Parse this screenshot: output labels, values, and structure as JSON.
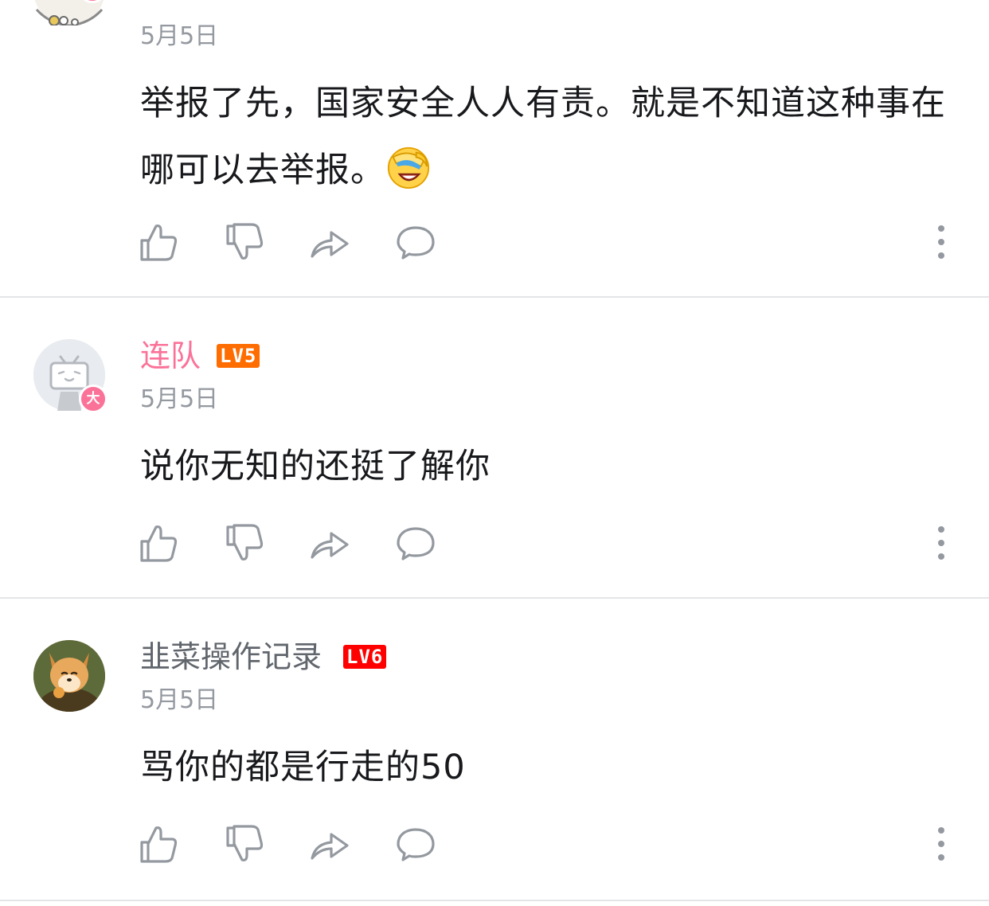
{
  "comments": [
    {
      "username": "",
      "level": "",
      "date": "5月5日",
      "content": "举报了先，国家安全人人有责。就是不知道这种事在哪可以去举报。",
      "emoji": "facepalm-laugh-emoji",
      "big_member_badge": "大"
    },
    {
      "username": "连队",
      "level": "LV5",
      "level_color": "#ff6c00",
      "date": "5月5日",
      "content": "说你无知的还挺了解你",
      "big_member_badge": "大"
    },
    {
      "username": "韭菜操作记录",
      "level": "LV6",
      "level_color": "#ff0000",
      "date": "5月5日",
      "content": "骂你的都是行走的50"
    }
  ],
  "icons": {
    "like": "thumbs-up-icon",
    "dislike": "thumbs-down-icon",
    "share": "share-icon",
    "reply": "comment-icon",
    "more": "more-vertical-icon"
  },
  "colors": {
    "vip_name": "#fb7299",
    "normal_name": "#61666d",
    "meta": "#9499a0",
    "text": "#18191c",
    "divider": "#e3e5e7",
    "icon": "#9499a0"
  }
}
